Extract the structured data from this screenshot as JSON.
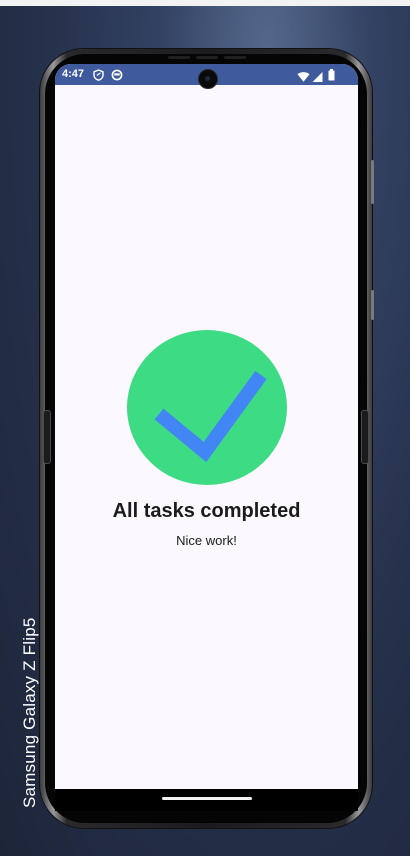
{
  "device": {
    "label": "Samsung Galaxy  Z  Flip5"
  },
  "status_bar": {
    "time": "4:47",
    "left_icons": [
      "shield-icon",
      "circle-sync-icon"
    ],
    "right_icons": [
      "wifi-icon",
      "cell-signal-icon",
      "battery-icon"
    ],
    "background": "#3f5b9e"
  },
  "completion": {
    "title": "All tasks completed",
    "subtitle": "Nice work!",
    "circle_color": "#3ddc84",
    "check_color": "#4285f4"
  }
}
